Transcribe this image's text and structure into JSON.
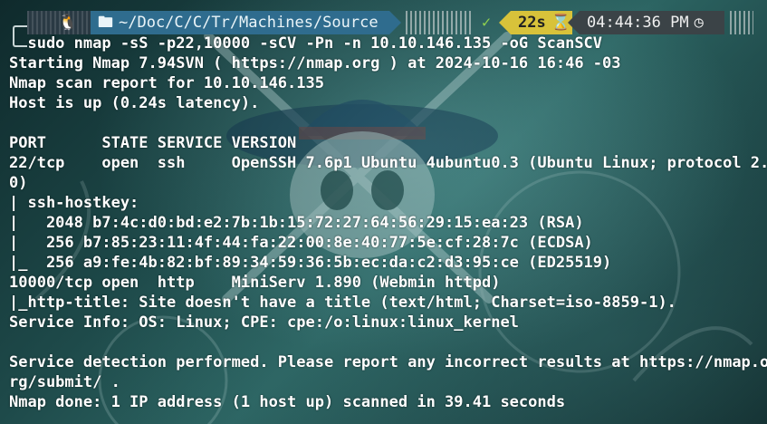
{
  "prompt": {
    "os_icon": "tux-icon",
    "path": "~/Doc/C/C/Tr/Machines/Source",
    "status_ok": "✓",
    "duration": "22s",
    "clock": "04:44:36 PM"
  },
  "command": "  sudo nmap -sS -p22,10000 -sCV -Pn -n 10.10.146.135 -oG ScanSCV",
  "output_lines": [
    "Starting Nmap 7.94SVN ( https://nmap.org ) at 2024-10-16 16:46 -03",
    "Nmap scan report for 10.10.146.135",
    "Host is up (0.24s latency).",
    "",
    "PORT      STATE SERVICE VERSION",
    "22/tcp    open  ssh     OpenSSH 7.6p1 Ubuntu 4ubuntu0.3 (Ubuntu Linux; protocol 2.",
    "0)",
    "| ssh-hostkey:",
    "|   2048 b7:4c:d0:bd:e2:7b:1b:15:72:27:64:56:29:15:ea:23 (RSA)",
    "|   256 b7:85:23:11:4f:44:fa:22:00:8e:40:77:5e:cf:28:7c (ECDSA)",
    "|_  256 a9:fe:4b:82:bf:89:34:59:36:5b:ec:da:c2:d3:95:ce (ED25519)",
    "10000/tcp open  http    MiniServ 1.890 (Webmin httpd)",
    "|_http-title: Site doesn't have a title (text/html; Charset=iso-8859-1).",
    "Service Info: OS: Linux; CPE: cpe:/o:linux:linux_kernel",
    "",
    "Service detection performed. Please report any incorrect results at https://nmap.o",
    "rg/submit/ .",
    "Nmap done: 1 IP address (1 host up) scanned in 39.41 seconds"
  ]
}
